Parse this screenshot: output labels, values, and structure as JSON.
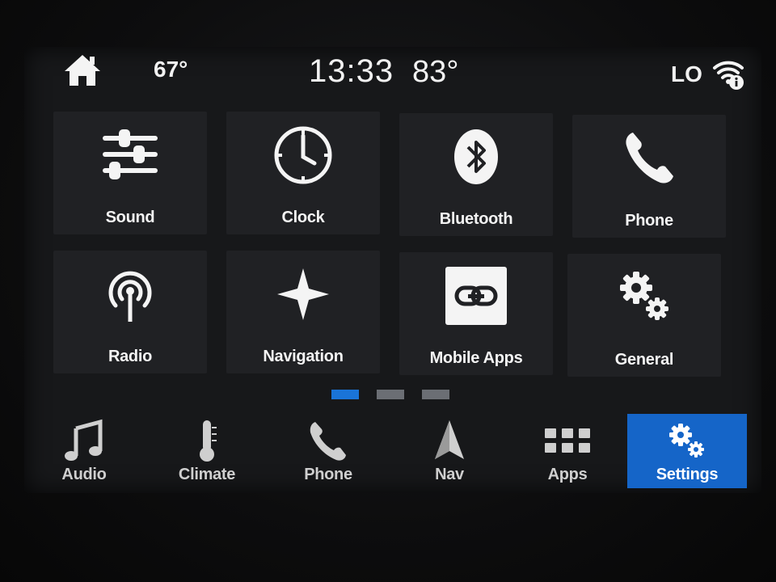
{
  "status": {
    "outside_temp": "67°",
    "time": "13:33",
    "cabin_temp": "83°",
    "fan_level": "LO"
  },
  "tiles": [
    {
      "label": "Sound",
      "icon": "sliders-icon"
    },
    {
      "label": "Clock",
      "icon": "clock-icon"
    },
    {
      "label": "Bluetooth",
      "icon": "bluetooth-icon"
    },
    {
      "label": "Phone",
      "icon": "phone-icon"
    },
    {
      "label": "Radio",
      "icon": "radio-antenna-icon"
    },
    {
      "label": "Navigation",
      "icon": "compass-star-icon"
    },
    {
      "label": "Mobile Apps",
      "icon": "link-icon"
    },
    {
      "label": "General",
      "icon": "gears-icon"
    }
  ],
  "pagination": {
    "pages": 3,
    "active_page": 1
  },
  "bottom_nav": [
    {
      "label": "Audio",
      "icon": "music-note-icon"
    },
    {
      "label": "Climate",
      "icon": "thermometer-icon"
    },
    {
      "label": "Phone",
      "icon": "phone-icon"
    },
    {
      "label": "Nav",
      "icon": "navigation-arrow-icon"
    },
    {
      "label": "Apps",
      "icon": "apps-grid-icon"
    },
    {
      "label": "Settings",
      "icon": "gears-icon",
      "active": true
    }
  ],
  "colors": {
    "accent": "#1565c8",
    "active_dot": "#1a74d8",
    "inactive_dot": "#6b6e74",
    "text": "#f4f4f4"
  }
}
